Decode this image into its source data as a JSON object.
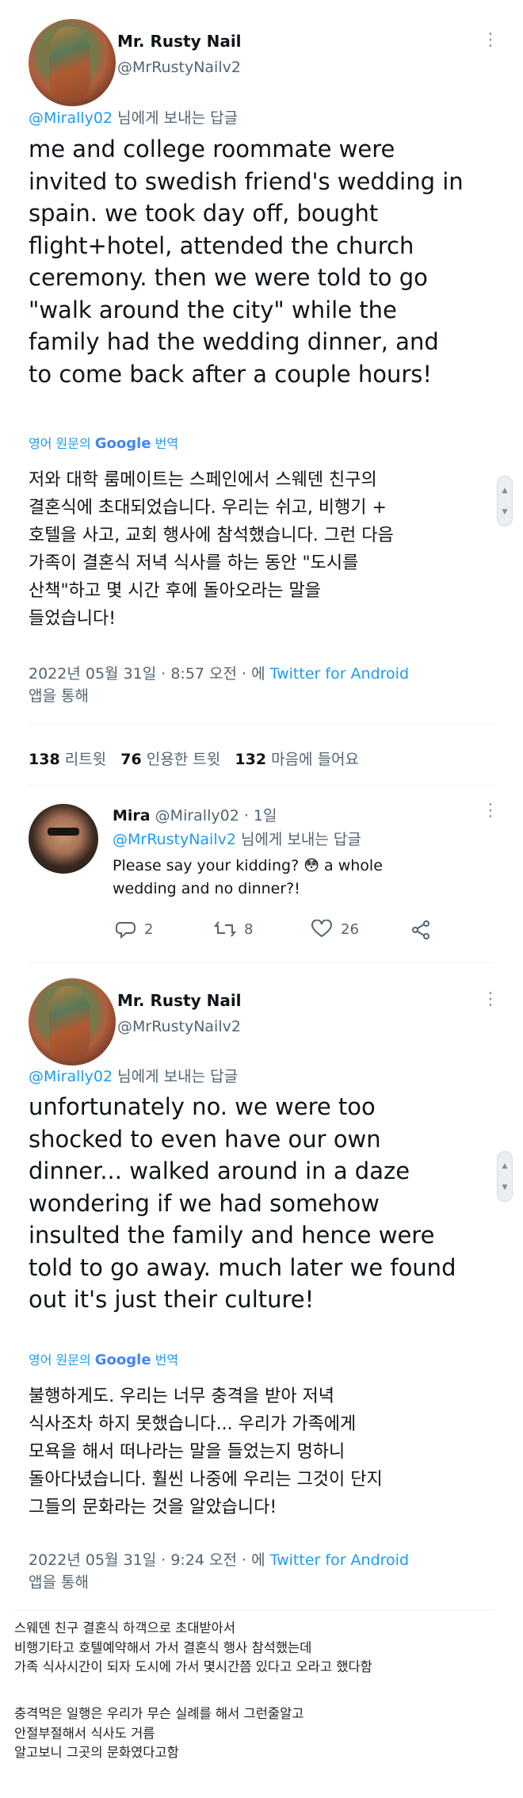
{
  "tweet1": {
    "name": "Mr. Rusty Nail",
    "handle": "@MrRustyNailv2",
    "reply_mention": "@Mirally02",
    "reply_suffix": " 님에게 보내는 답글",
    "text_lines": [
      "me and college roommate were",
      "invited to swedish friend's wedding in",
      "spain. we took day off, bought",
      "flight+hotel, attended the church",
      "ceremony. then we were told to go",
      "\"walk around the city\" while the",
      "family had the wedding dinner, and",
      "to come back after a couple hours!"
    ],
    "translate_prefix": "영어 원문의",
    "translate_google": "Google",
    "translate_suffix": "번역",
    "translation_lines": [
      "저와 대학 룸메이트는 스페인에서 스웨덴 친구의",
      "결혼식에 초대되었습니다. 우리는 쉬고, 비행기 +",
      "호텔을 사고, 교회 행사에 참석했습니다. 그런 다음",
      "가족이 결혼식 저녁 식사를 하는 동안 \"도시를",
      "산책\"하고 몇 시간 후에 돌아오라는 말을",
      "들었습니다!"
    ],
    "timestamp": "2022년 05월 31일 · 8:57 오전 · 에 ",
    "source": "Twitter for Android",
    "via": "앱을 통해",
    "stats": {
      "retweets": "138",
      "retweets_label": "리트윗",
      "quotes": "76",
      "quotes_label": "인용한 트윗",
      "likes": "132",
      "likes_label": "마음에 들어요"
    }
  },
  "tweet2": {
    "name": "Mira",
    "handle": "@Mirally02",
    "time": "· 1일",
    "reply_mention": "@MrRustyNailv2",
    "reply_suffix": " 님에게 보내는 답글",
    "text_line1": "Please say your kidding? 😳 a whole",
    "text_line2": "wedding and no dinner?!",
    "replies": "2",
    "retweets": "8",
    "likes": "26"
  },
  "tweet3": {
    "name": "Mr. Rusty Nail",
    "handle": "@MrRustyNailv2",
    "reply_mention": "@Mirally02",
    "reply_suffix": " 님에게 보내는 답글",
    "text_lines": [
      "unfortunately no. we were too",
      "shocked to even have our own",
      "dinner... walked around in a daze",
      "wondering if we had somehow",
      "insulted the family and hence were",
      "told to go away. much later we found",
      "out it's just their culture!"
    ],
    "translate_prefix": "영어 원문의",
    "translate_google": "Google",
    "translate_suffix": "번역",
    "translation_lines": [
      "불행하게도. 우리는 너무 충격을 받아 저녁",
      "식사조차 하지 못했습니다... 우리가 가족에게",
      "모욕을 해서 떠나라는 말을 들었는지 멍하니",
      "돌아다녔습니다. 훨씬 나중에 우리는 그것이 단지",
      "그들의 문화라는 것을 알았습니다!"
    ],
    "timestamp": "2022년 05월 31일 · 9:24 오전 · 에 ",
    "source": "Twitter for Android",
    "via": "앱을 통해"
  },
  "caption": {
    "para1": [
      "스웨덴 친구 결혼식 하객으로 초대받아서",
      "비행기타고 호텔예약해서 가서 결혼식 행사 참석했는데",
      "가족 식사시간이 되자 도시에 가서 몇시간쯤 있다고 오라고 했다함"
    ],
    "para2": [
      "충격먹은 일행은 우리가 무슨 실례를 해서 그런줄알고",
      "안절부절해서 식사도 거름",
      "알고보니 그곳의 문화였다고함"
    ]
  },
  "icons": {
    "more": "more-vertical-icon",
    "reply": "reply-icon",
    "retweet": "retweet-icon",
    "like": "heart-icon",
    "share": "share-icon"
  },
  "colors": {
    "link": "#1d9bf0",
    "muted": "#536471",
    "text": "#0f1419"
  }
}
